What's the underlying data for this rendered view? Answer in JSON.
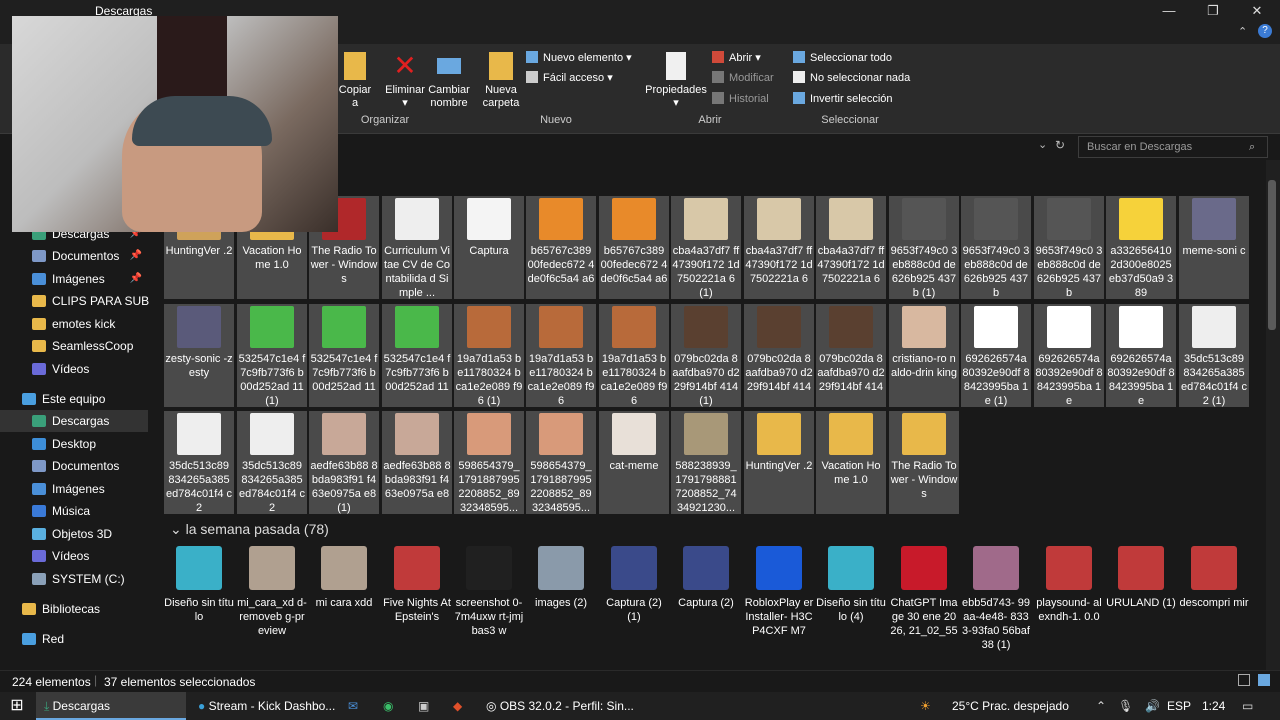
{
  "window": {
    "title": "Descargas"
  },
  "ribbon": {
    "copiar": "Copiar",
    "copiar2": "a",
    "eliminar": "Eliminar",
    "cambiar_nombre": "Cambiar nombre",
    "nueva_carpeta": "Nueva carpeta",
    "nuevo_elemento": "Nuevo elemento",
    "facil_acceso": "Fácil acceso",
    "propiedades": "Propiedades",
    "abrir": "Abrir",
    "modificar": "Modificar",
    "historial": "Historial",
    "seleccionar_todo": "Seleccionar todo",
    "no_seleccionar_nada": "No seleccionar nada",
    "invertir_seleccion": "Invertir selección",
    "grp_organizar": "Organizar",
    "grp_nuevo": "Nuevo",
    "grp_abrir": "Abrir",
    "grp_seleccionar": "Seleccionar"
  },
  "search": {
    "placeholder": "Buscar en Descargas"
  },
  "nav": {
    "items": [
      {
        "label": "Descargas",
        "pinned": true
      },
      {
        "label": "Documentos",
        "pinned": true
      },
      {
        "label": "Imágenes",
        "pinned": true
      },
      {
        "label": "CLIPS PARA SUBIR"
      },
      {
        "label": "emotes kick"
      },
      {
        "label": "SeamlessCoop"
      },
      {
        "label": "Vídeos"
      },
      {
        "label": "Este equipo"
      },
      {
        "label": "Descargas"
      },
      {
        "label": "Desktop"
      },
      {
        "label": "Documentos"
      },
      {
        "label": "Imágenes"
      },
      {
        "label": "Música"
      },
      {
        "label": "Objetos 3D"
      },
      {
        "label": "Vídeos"
      },
      {
        "label": "SYSTEM (C:)"
      },
      {
        "label": "Bibliotecas"
      },
      {
        "label": "Red"
      }
    ]
  },
  "files_row1": [
    "HuntingVer .2",
    "Vacation Home 1.0",
    "The Radio Tower - Windows",
    "Curriculum Vitae CV de Contabilida d Simple ...",
    "Captura",
    "b65767c389 00fedec672 4de0f6c5a4 a6",
    "b65767c389 00fedec672 4de0f6c5a4 a6",
    "cba4a37df7 ff47390f172 1d7502221a 6 (1)",
    "cba4a37df7 ff47390f172 1d7502221a 6",
    "cba4a37df7 ff47390f172 1d7502221a 6",
    "9653f749c0 3eb888c0d de626b925 437b (1)",
    "9653f749c0 3eb888c0d de626b925 437b",
    "9653f749c0 3eb888c0d de626b925 437b",
    "a332656410 2d300e8025 eb37d50a9 389",
    "meme-soni c"
  ],
  "files_row2": [
    "zesty-sonic -zesty",
    "532547c1e4 f7c9fb773f6 b00d252ad 11 (1)",
    "532547c1e4 f7c9fb773f6 b00d252ad 11",
    "532547c1e4 f7c9fb773f6 b00d252ad 11",
    "19a7d1a53 be11780324 bca1e2e089 f96 (1)",
    "19a7d1a53 be11780324 bca1e2e089 f96",
    "19a7d1a53 be11780324 bca1e2e089 f96",
    "079bc02da 8aafdba970 d229f914bf 414 (1)",
    "079bc02da 8aafdba970 d229f914bf 414",
    "079bc02da 8aafdba970 d229f914bf 414",
    "cristiano-ro naldo-drin king",
    "692626574a 80392e90df 88423995ba 1e (1)",
    "692626574a 80392e90df 88423995ba 1e",
    "692626574a 80392e90df 88423995ba 1e",
    "35dc513c89 834265a385 ed784c01f4 c2 (1)"
  ],
  "files_row3": [
    "35dc513c89 834265a385 ed784c01f4 c2",
    "35dc513c89 834265a385 ed784c01f4 c2",
    "aedfe63b88 8bda983f91 f463e0975a e8 (1)",
    "aedfe63b88 8bda983f91 f463e0975a e8",
    "598654379_ 1791887995 2208852_89 32348595...",
    "598654379_ 1791887995 2208852_89 32348595...",
    "cat-meme",
    "588238939_ 1791798881 7208852_74 34921230...",
    "HuntingVer .2",
    "Vacation Home 1.0",
    "The Radio Tower - Windows"
  ],
  "section": {
    "label": "la semana pasada (78)"
  },
  "files_week": [
    "Diseño sin título",
    "mi_cara_xd d-removeb g-preview",
    "mi cara xdd",
    "Five Nights At Epstein's",
    "screenshot 0-7m4uxw rt-jmjbas3 w",
    "images (2)",
    "Captura (2) (1)",
    "Captura (2)",
    "RobloxPlay erInstaller- H3CP4CXF M7",
    "Diseño sin título (4)",
    "ChatGPT Image 30 ene 2026, 21_02_55",
    "ebb5d743- 99aa-4e48- 8333-93fa0 56baf38 (1)",
    "playsound- alexndh-1. 0.0",
    "URULAND (1)",
    "descompri mir"
  ],
  "status": {
    "count": "224 elementos",
    "selected": "37 elementos seleccionados"
  },
  "taskbar": {
    "explorer": "Descargas",
    "stream": "Stream - Kick Dashbo...",
    "obs": "OBS 32.0.2 - Perfil: Sin...",
    "weather": "25°C  Prac. despejado",
    "lang": "ESP",
    "time": "1:24"
  },
  "colors": {
    "accent": "#6aa8e0",
    "folder": "#e8b84a",
    "bg": "#191919",
    "ribbon": "#2b2b2b"
  }
}
